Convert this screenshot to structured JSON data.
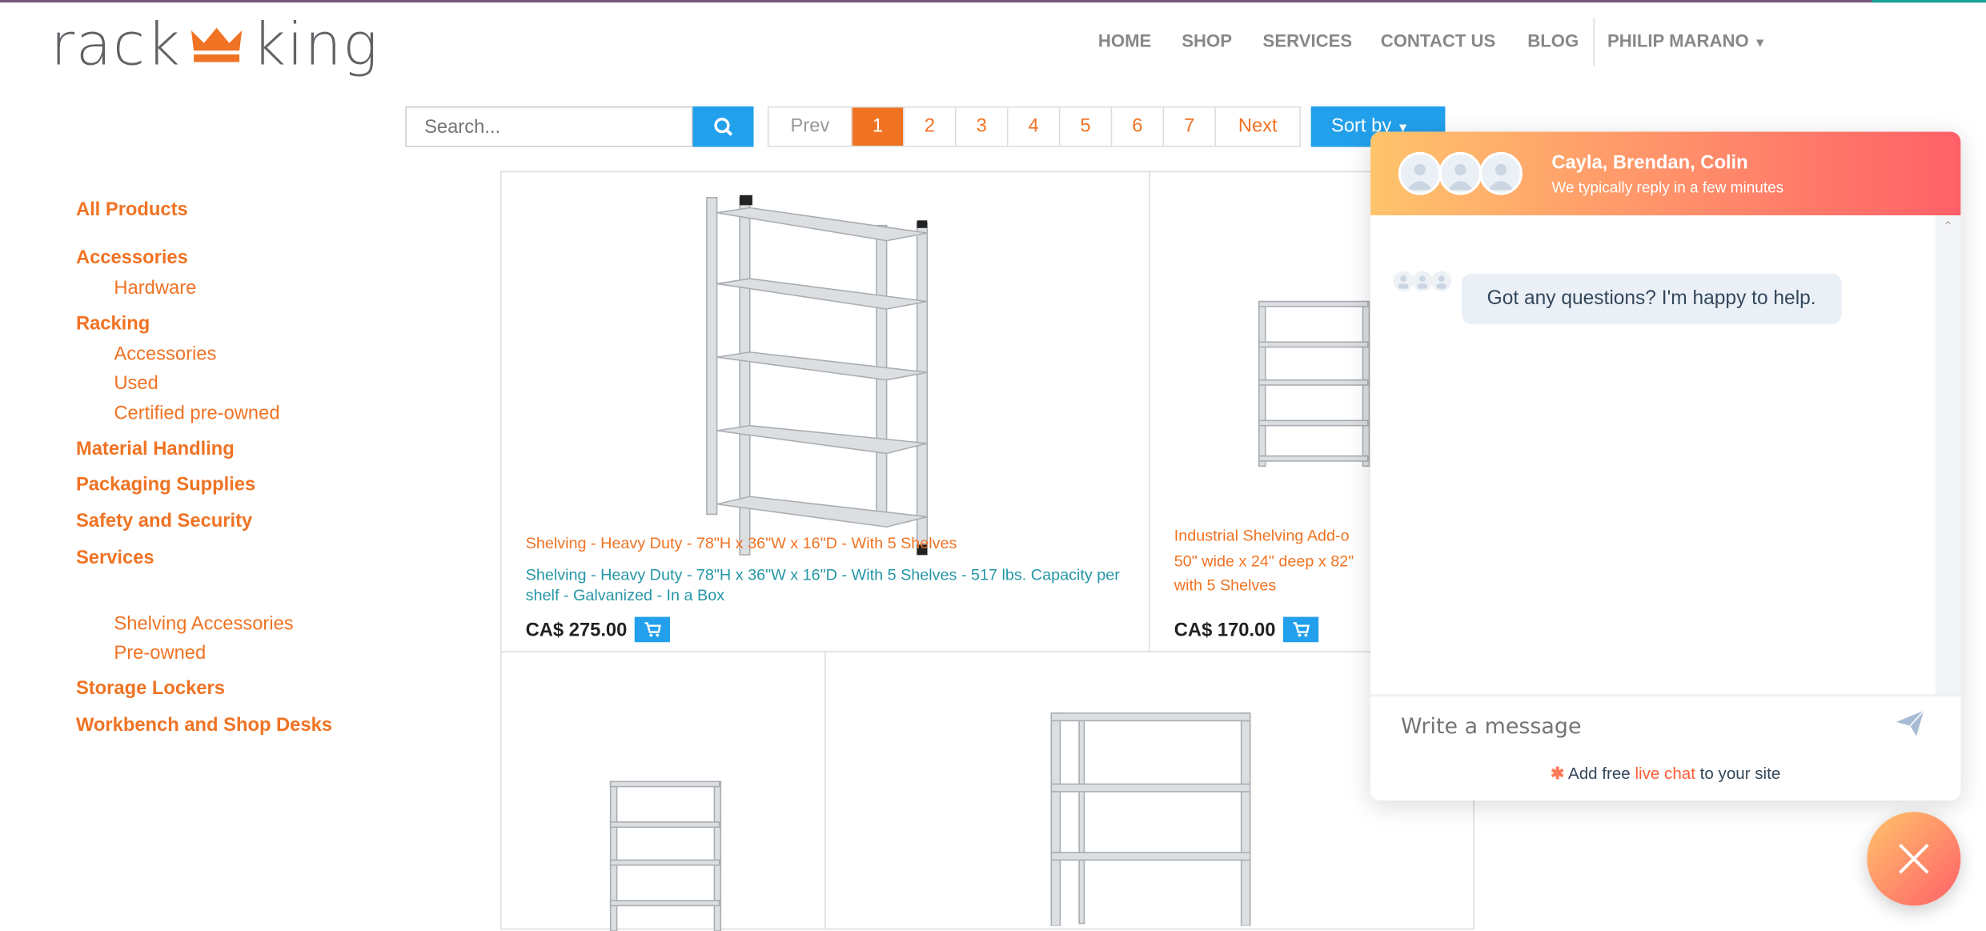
{
  "header": {
    "logo_left": "rack",
    "logo_right": "king",
    "nav": [
      {
        "label": "HOME"
      },
      {
        "label": "SHOP"
      },
      {
        "label": "SERVICES"
      },
      {
        "label": "CONTACT US"
      },
      {
        "label": "BLOG"
      }
    ],
    "user_menu": "PHILIP MARANO"
  },
  "toolbar": {
    "search_placeholder": "Search...",
    "pager": {
      "prev": "Prev",
      "pages": [
        "1",
        "2",
        "3",
        "4",
        "5",
        "6",
        "7"
      ],
      "active": "1",
      "next": "Next"
    },
    "sort_label": "Sort by"
  },
  "sidebar": {
    "items": [
      {
        "label": "All Products",
        "level": 0
      },
      {
        "label": "Accessories",
        "level": 0
      },
      {
        "label": "Hardware",
        "level": 1
      },
      {
        "label": "Racking",
        "level": 0
      },
      {
        "label": "Accessories",
        "level": 1
      },
      {
        "label": "Used",
        "level": 1
      },
      {
        "label": "Certified pre-owned",
        "level": 1
      },
      {
        "label": "Material Handling",
        "level": 0
      },
      {
        "label": "Packaging Supplies",
        "level": 0
      },
      {
        "label": "Safety and Security",
        "level": 0
      },
      {
        "label": "Services",
        "level": 0
      },
      {
        "label": "Shelving Accessories",
        "level": 1
      },
      {
        "label": "Pre-owned",
        "level": 1
      },
      {
        "label": "Storage Lockers",
        "level": 0
      },
      {
        "label": "Workbench and Shop Desks",
        "level": 0
      }
    ]
  },
  "products": [
    {
      "name": "Shelving - Heavy Duty - 78\"H x 36\"W x 16\"D - With 5 Shelves",
      "description": "Shelving - Heavy Duty - 78\"H x 36\"W x 16\"D - With 5 Shelves - 517 lbs. Capacity per shelf - Galvanized - In a Box",
      "price": "CA$ 275.00"
    },
    {
      "name_lines": [
        "Industrial Shelving Add-o",
        "50\" wide x 24\" deep x 82\"",
        "with 5 Shelves"
      ],
      "price": "CA$ 170.00"
    }
  ],
  "chat": {
    "agents": "Cayla, Brendan, Colin",
    "subtitle": "We typically reply in a few minutes",
    "message": "Got any questions? I'm happy to help.",
    "input_placeholder": "Write a message",
    "footer_pre": "Add free ",
    "footer_link": "live chat",
    "footer_post": " to your site"
  },
  "colors": {
    "brand_orange": "#f07323",
    "action_blue": "#22a0ec",
    "teal_text": "#2596a6",
    "chat_gradient_start": "#ffc46c",
    "chat_gradient_end": "#ff6068"
  }
}
